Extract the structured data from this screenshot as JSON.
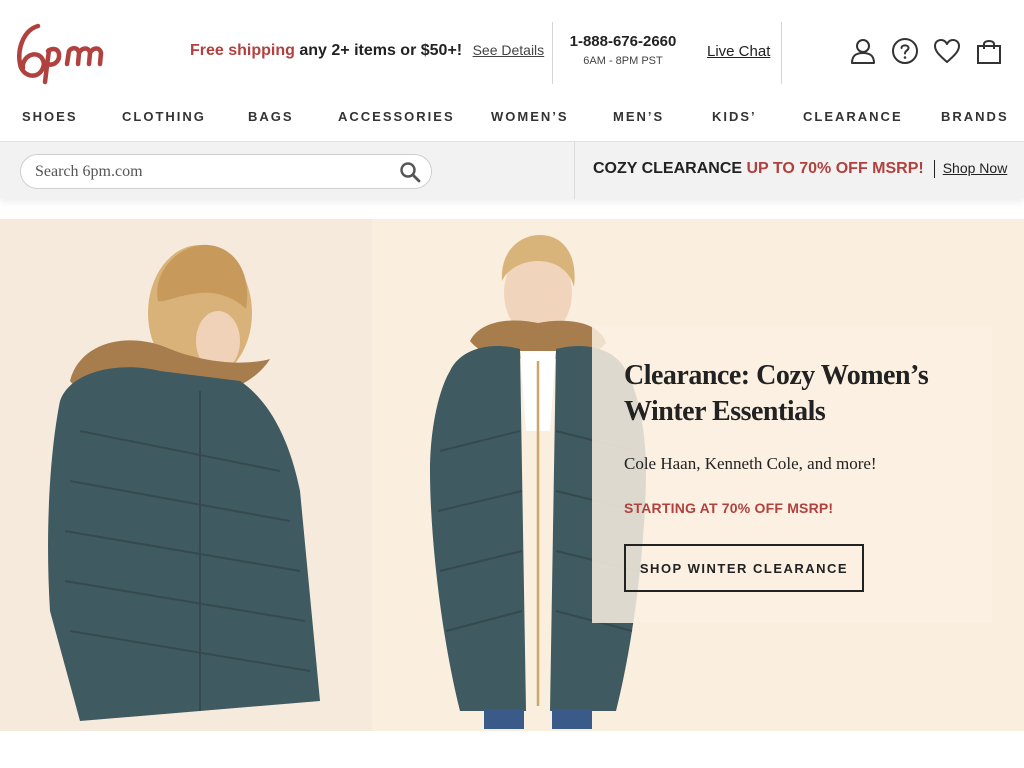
{
  "brand": {
    "logo_text": "6pm",
    "logo_color": "#b0413e"
  },
  "promo": {
    "highlight": "Free shipping",
    "rest": "any 2+ items or $50+!",
    "details_link": "See Details"
  },
  "contact": {
    "phone": "1-888-676-2660",
    "hours": "6AM - 8PM PST",
    "live_chat": "Live Chat"
  },
  "header_icons": [
    "account-icon",
    "help-icon",
    "wishlist-heart-icon",
    "shopping-bag-icon"
  ],
  "nav": {
    "items": [
      "SHOES",
      "CLOTHING",
      "BAGS",
      "ACCESSORIES",
      "WOMEN’S",
      "MEN’S",
      "KIDS’",
      "CLEARANCE",
      "BRANDS"
    ]
  },
  "search": {
    "placeholder": "Search 6pm.com",
    "icon": "search-icon"
  },
  "sitewide_banner": {
    "label": "COZY CLEARANCE",
    "offer": "UP TO 70% OFF MSRP!",
    "link": "Shop Now"
  },
  "hero": {
    "title": "Clearance: Cozy Women’s Winter Essentials",
    "subtitle": "Cole Haan, Kenneth Cole, and more!",
    "offer": "STARTING AT 70% OFF MSRP!",
    "cta": "SHOP WINTER CLEARANCE"
  },
  "colors": {
    "accent": "#b0413e",
    "hero_bg": "#faeedf",
    "coat": "#3f5a60"
  }
}
